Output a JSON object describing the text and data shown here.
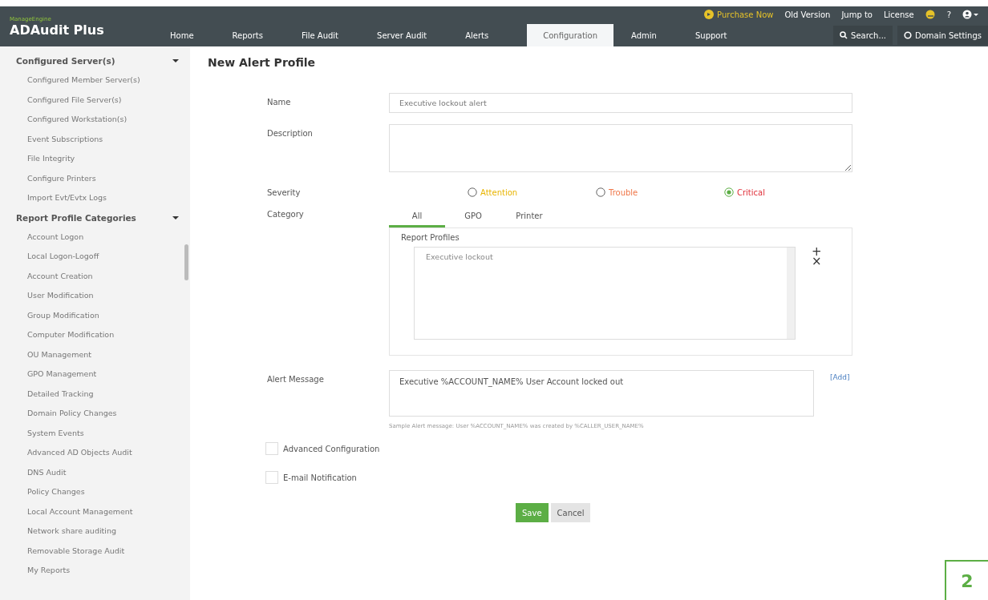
{
  "header": {
    "brand": "ManageEngine",
    "product": "ADAudit Plus",
    "top_links": [
      {
        "kind": "purchase",
        "label": "Purchase Now"
      },
      {
        "kind": "link",
        "label": "Old Version"
      },
      {
        "kind": "link",
        "label": "Jump to"
      },
      {
        "kind": "link",
        "label": "License"
      },
      {
        "kind": "icon",
        "label": "?"
      }
    ],
    "nav": [
      {
        "label": "Home",
        "selected": false
      },
      {
        "label": "Reports",
        "selected": false
      },
      {
        "label": "File Audit",
        "selected": false
      },
      {
        "label": "Server Audit",
        "selected": false
      },
      {
        "label": "Alerts",
        "selected": false
      },
      {
        "label": "Configuration",
        "selected": true
      },
      {
        "label": "Admin",
        "selected": false
      },
      {
        "label": "Support",
        "selected": false
      }
    ],
    "search": "Search...",
    "domain_settings": "Domain Settings"
  },
  "sidebar": [
    {
      "title": "Configured Server(s)",
      "expanded": true,
      "items": [
        "Configured Member Server(s)",
        "Configured File Server(s)",
        "Configured Workstation(s)",
        "Event Subscriptions",
        "File Integrity",
        "Configure Printers",
        "Import Evt/Evtx Logs"
      ]
    },
    {
      "title": "Report Profile Categories",
      "expanded": true,
      "items": [
        "Account Logon",
        "Local Logon-Logoff",
        "Account Creation",
        "User Modification",
        "Group Modification",
        "Computer Modification",
        "OU Management",
        "GPO Management",
        "Detailed Tracking",
        "Domain Policy Changes",
        "System Events",
        "Advanced AD Objects Audit",
        "DNS Audit",
        "Policy Changes",
        "Local Account Management",
        "Network share auditing",
        "Removable Storage Audit",
        "My Reports"
      ]
    }
  ],
  "page_title": "New Alert Profile",
  "form": {
    "name_label": "Name",
    "name_value": "Executive lockout alert",
    "description_label": "Description",
    "severity_label": "Severity",
    "severities": [
      {
        "label": "Attention",
        "color": "#e8b400",
        "selected": false
      },
      {
        "label": "Trouble",
        "color": "#f0784a",
        "selected": false
      },
      {
        "label": "Critical",
        "color": "#e0303a",
        "selected": true
      }
    ],
    "category_label": "Category",
    "category_tabs": [
      {
        "label": "All",
        "selected": true
      },
      {
        "label": "GPO",
        "selected": false
      },
      {
        "label": "Printer",
        "selected": false
      }
    ],
    "report_profiles_label": "Report Profiles",
    "report_profiles": [
      "Executive lockout"
    ],
    "add_symbol": "+",
    "remove_symbol": "×",
    "alert_message_label": "Alert Message",
    "alert_message": "Executive %ACCOUNT_NAME% User Account locked out",
    "add_link": "[Add]",
    "sample": "Sample Alert message: User %ACCOUNT_NAME% was created by %CALLER_USER_NAME%",
    "options": [
      {
        "label": "Advanced Configuration",
        "checked": false
      },
      {
        "label": "E-mail Notification",
        "checked": false
      }
    ],
    "buttons": [
      {
        "kind": "primary",
        "label": "Save"
      },
      {
        "kind": "secondary",
        "label": "Cancel"
      }
    ]
  },
  "page_number": "2"
}
